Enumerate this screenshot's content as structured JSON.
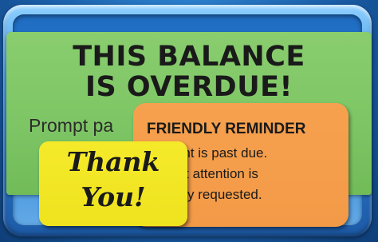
{
  "green_sticker": {
    "title_line1": "THIS BALANCE",
    "title_line2": "IS OVERDUE!",
    "body": "Prompt pa"
  },
  "orange_sticker": {
    "title": "FRIENDLY REMINDER",
    "line1": "account is past due.",
    "line2": "prompt attention is",
    "line3": "rteously requested."
  },
  "yellow_sticker": {
    "line1": "Thank",
    "line2": "You!"
  },
  "colors": {
    "background": "#1a5ea8",
    "frame": "#3e96e3",
    "green": "#7dc564",
    "orange": "#f39a47",
    "yellow": "#efe31f",
    "text": "#1a1a1a"
  }
}
